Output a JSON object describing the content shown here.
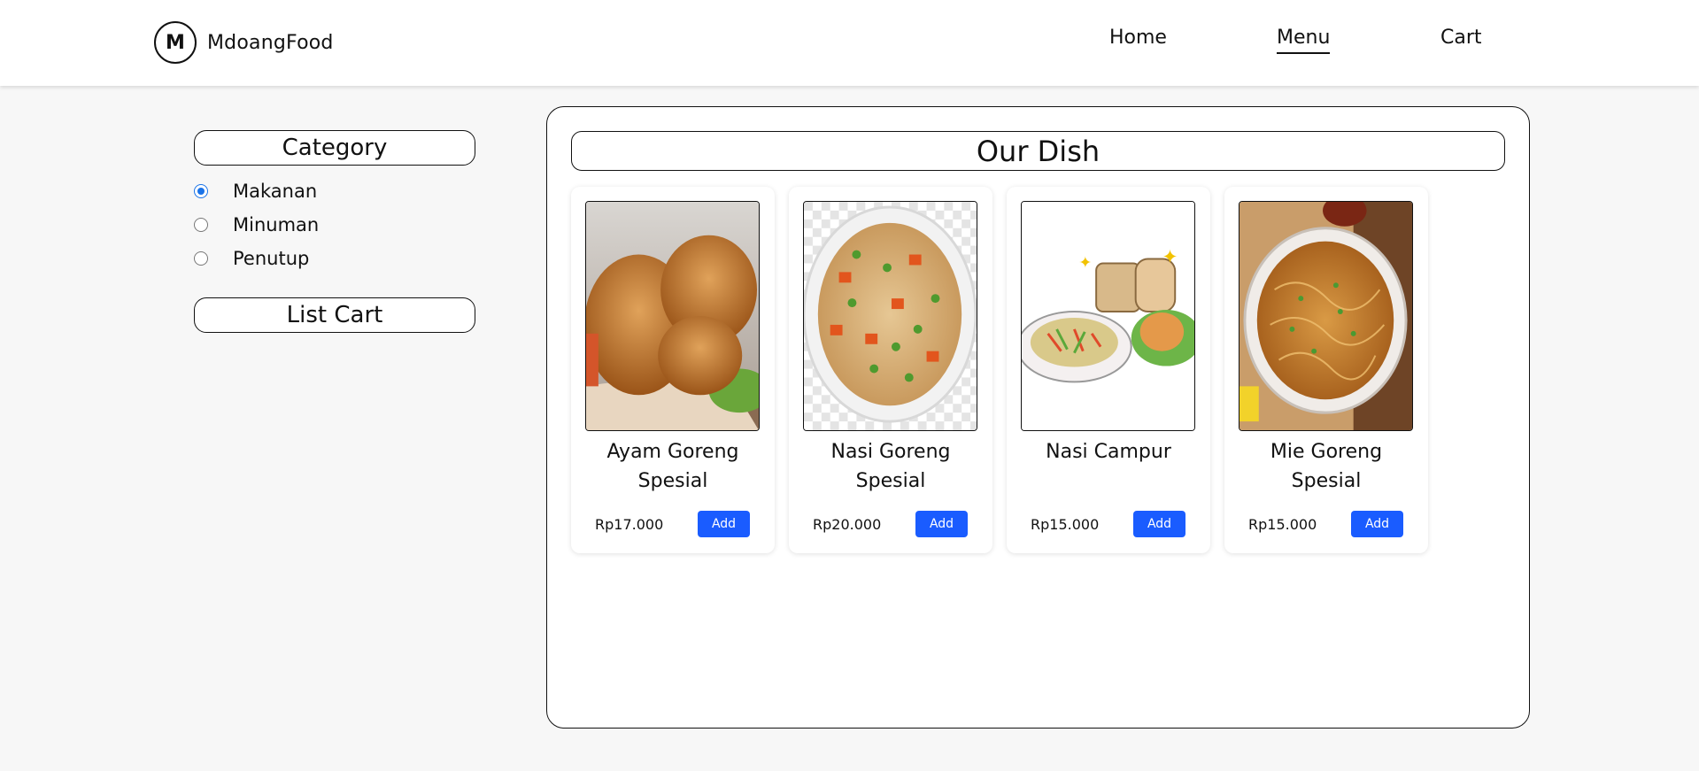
{
  "navbar": {
    "logo_letter": "M",
    "brand_name": "MdoangFood",
    "links": [
      {
        "label": "Home"
      },
      {
        "label": "Menu"
      },
      {
        "label": "Cart"
      }
    ]
  },
  "sidebar": {
    "category_title": "Category",
    "categories": [
      {
        "label": "Makanan",
        "selected": true
      },
      {
        "label": "Minuman",
        "selected": false
      },
      {
        "label": "Penutup",
        "selected": false
      }
    ],
    "cart_title": "List Cart"
  },
  "main": {
    "title": "Our Dish",
    "products": [
      {
        "name": "Ayam Goreng Spesial",
        "price": "Rp17.000",
        "button": "Add",
        "image_icon": "fried-chicken-image"
      },
      {
        "name": "Nasi Goreng Spesial",
        "price": "Rp20.000",
        "button": "Add",
        "image_icon": "fried-rice-image"
      },
      {
        "name": "Nasi Campur",
        "price": "Rp15.000",
        "button": "Add",
        "image_icon": "mixed-rice-image"
      },
      {
        "name": "Mie Goreng Spesial",
        "price": "Rp15.000",
        "button": "Add",
        "image_icon": "fried-noodles-image"
      }
    ]
  },
  "colors": {
    "accent": "#1a5cff",
    "radio_selected": "#1a73e8",
    "page_background": "#f7f7f7"
  }
}
